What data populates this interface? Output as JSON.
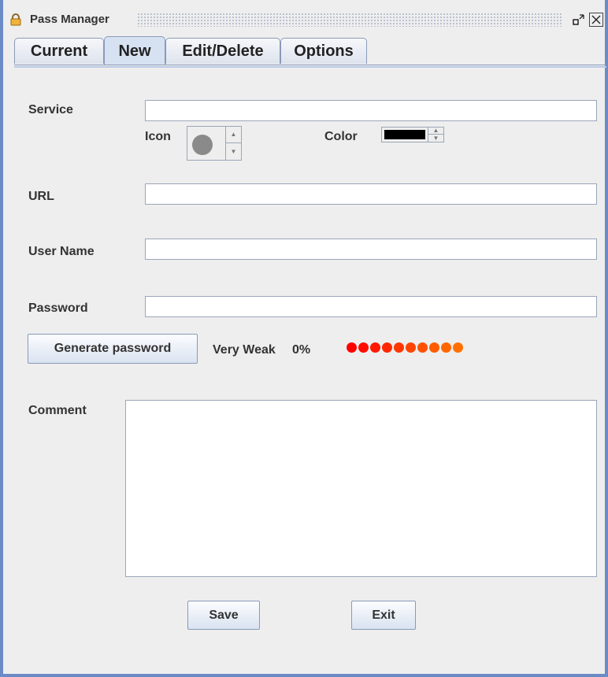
{
  "window": {
    "title": "Pass Manager"
  },
  "tabs": [
    {
      "label": "Current"
    },
    {
      "label": "New"
    },
    {
      "label": "Edit/Delete"
    },
    {
      "label": "Options"
    }
  ],
  "form": {
    "service_label": "Service",
    "service_value": "",
    "icon_label": "Icon",
    "color_label": "Color",
    "color_value": "#000000",
    "url_label": "URL",
    "url_value": "",
    "username_label": "User Name",
    "username_value": "",
    "password_label": "Password",
    "password_value": "",
    "generate_label": "Generate password",
    "strength_text": "Very Weak",
    "strength_percent": "0%",
    "strength_fraction": 0,
    "strength_dot_colors": [
      "#ff0000",
      "#ff0c00",
      "#ff1a00",
      "#ff2800",
      "#ff3600",
      "#ff4400",
      "#ff5200",
      "#ff5c00",
      "#ff6600",
      "#ff7000"
    ],
    "comment_label": "Comment",
    "comment_value": ""
  },
  "actions": {
    "save_label": "Save",
    "exit_label": "Exit"
  },
  "icons": {
    "title": "lock-icon",
    "restore": "restore-icon",
    "close": "close-icon",
    "icon_preview": "gray-circle-icon"
  }
}
